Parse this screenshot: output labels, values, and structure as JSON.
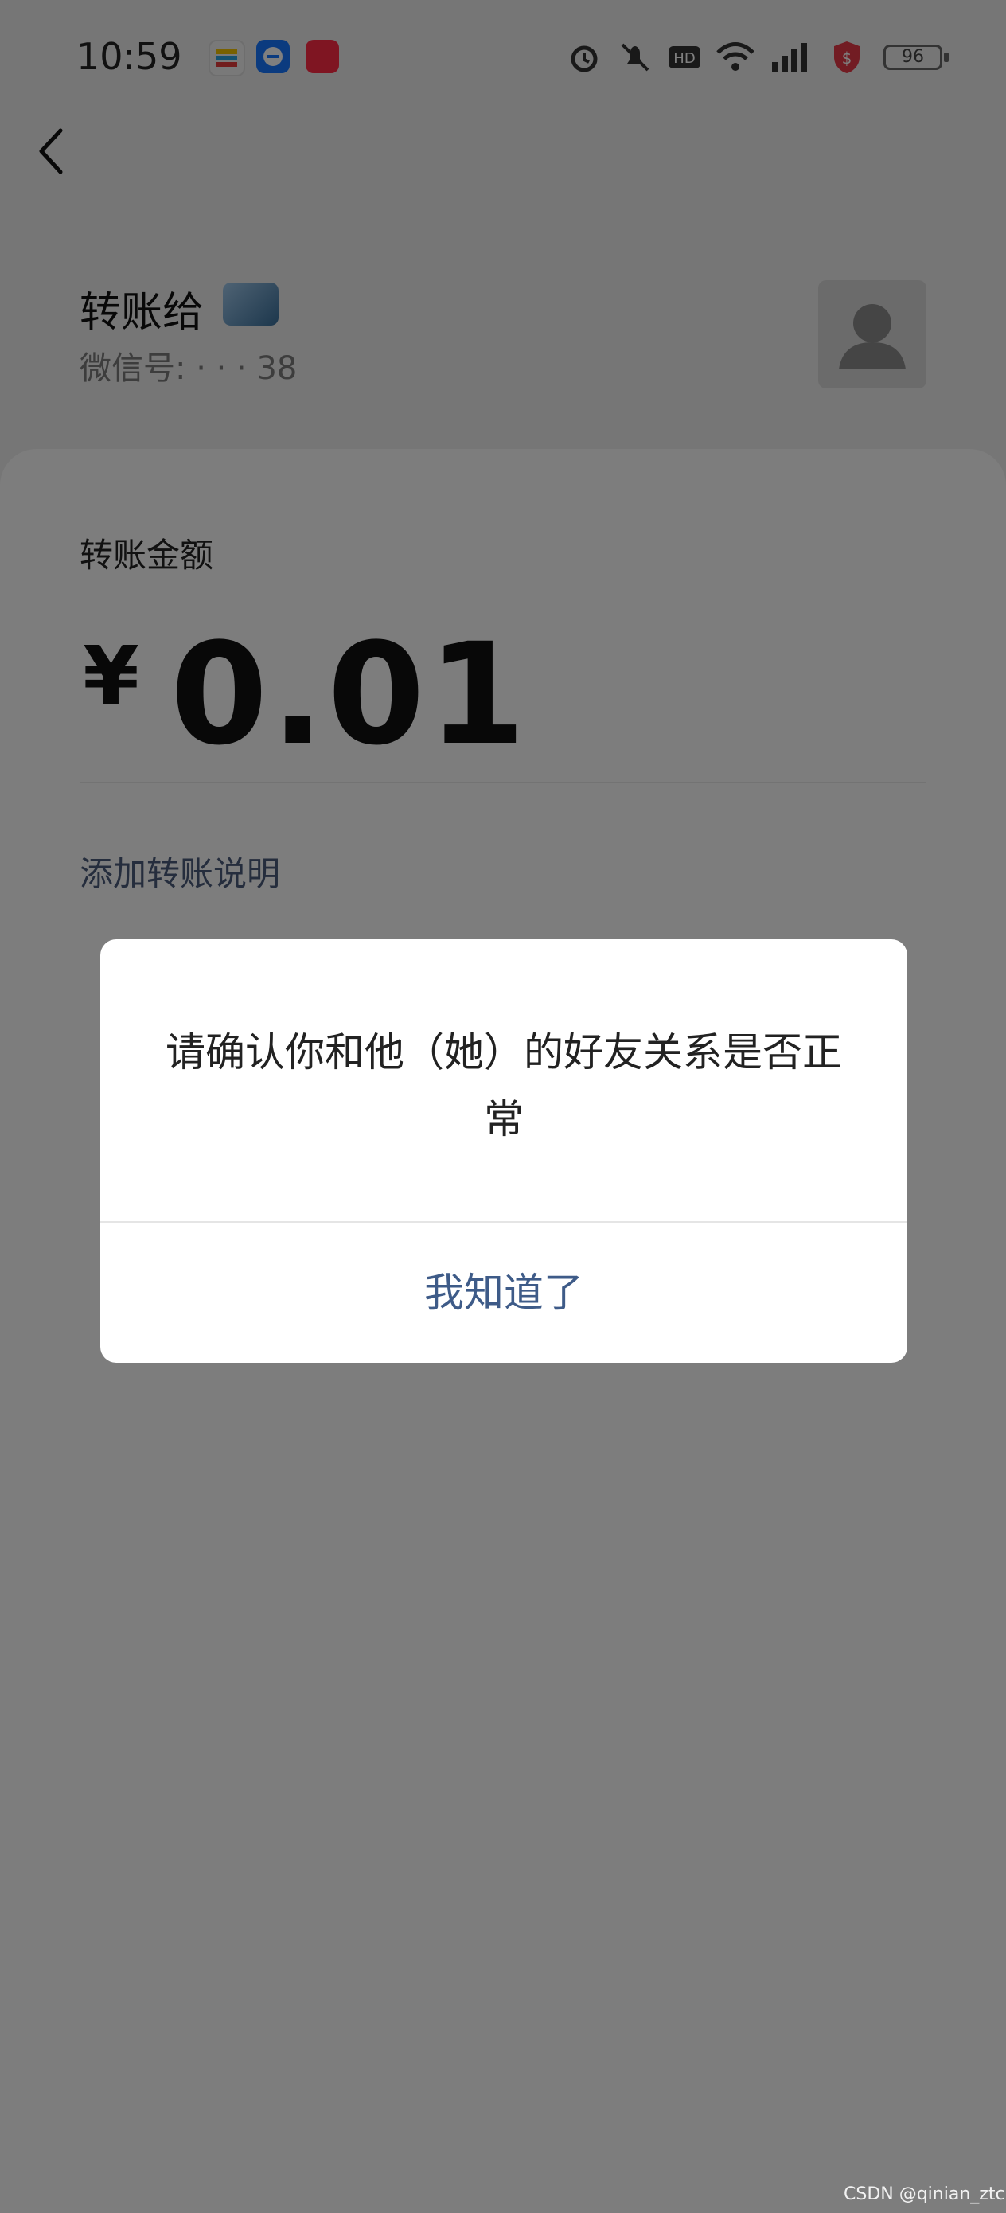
{
  "status_bar": {
    "time": "10:59",
    "app_icons": [
      "wallet-app-icon",
      "alipay-app-icon",
      "red-app-icon"
    ],
    "system_icons": [
      "alarm-icon",
      "mute-icon",
      "hd-icon",
      "wifi-icon",
      "signal-icon",
      "security-icon"
    ],
    "battery": "96"
  },
  "header": {
    "transfer_to": "转账给",
    "wechat_id": "微信号: ·  ·  ·  38"
  },
  "form": {
    "amount_label": "转账金额",
    "currency": "¥",
    "amount": "0.01",
    "add_note": "添加转账说明"
  },
  "dialog": {
    "message": "请确认你和他（她）的好友关系是否正常",
    "confirm": "我知道了"
  },
  "watermark": "CSDN @qinian_ztc",
  "colors": {
    "link_blue": "#4a5b7a",
    "dialog_button": "#3e5b88",
    "overlay": "rgba(0,0,0,0.5)"
  }
}
